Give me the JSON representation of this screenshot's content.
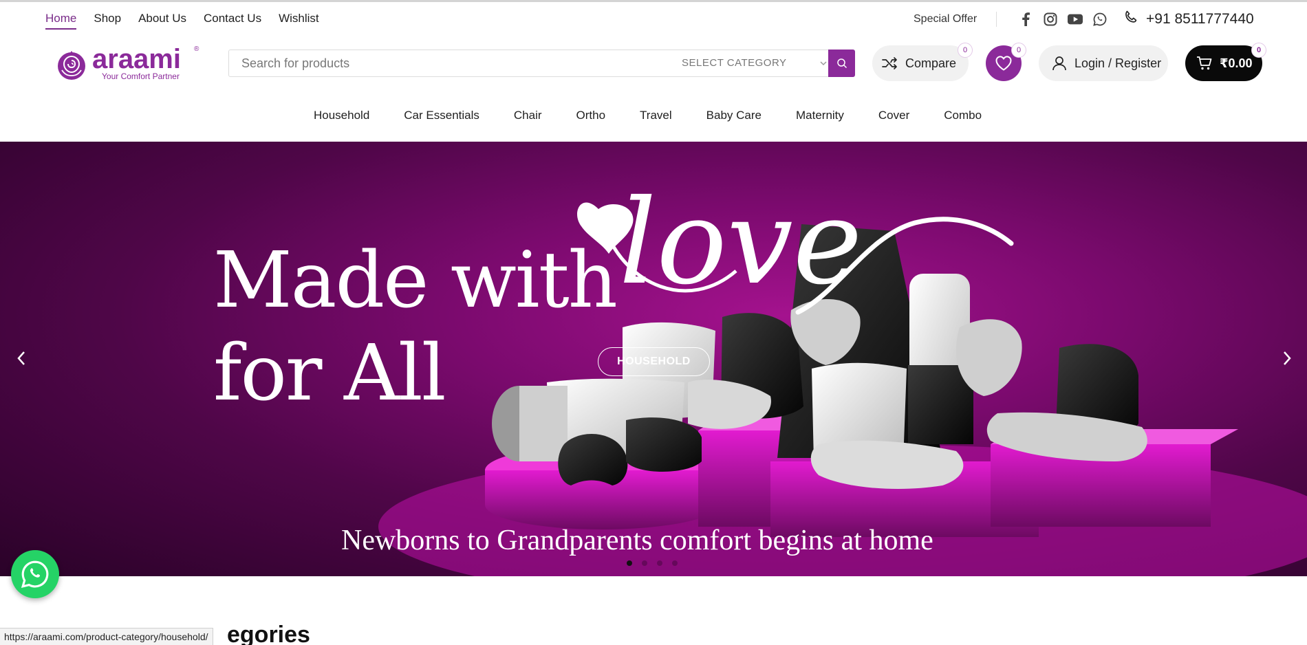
{
  "top_nav": [
    {
      "label": "Home",
      "active": true
    },
    {
      "label": "Shop"
    },
    {
      "label": "About Us"
    },
    {
      "label": "Contact Us"
    },
    {
      "label": "Wishlist"
    }
  ],
  "special_offer": "Special Offer",
  "socials": [
    "facebook-icon",
    "instagram-icon",
    "youtube-icon",
    "whatsapp-icon"
  ],
  "phone": "+91 8511777440",
  "logo": {
    "name": "araami",
    "tagline": "Your Comfort Partner",
    "reg": "®"
  },
  "search": {
    "placeholder": "Search for products",
    "category": "SELECT CATEGORY"
  },
  "compare": {
    "label": "Compare",
    "count": "0"
  },
  "wishlist": {
    "count": "0"
  },
  "login": {
    "label": "Login / Register"
  },
  "cart": {
    "total": "₹0.00",
    "count": "0"
  },
  "categories": [
    "Household",
    "Car Essentials",
    "Chair",
    "Ortho",
    "Travel",
    "Baby Care",
    "Maternity",
    "Cover",
    "Combo"
  ],
  "hero": {
    "line1": "Made with",
    "love": "love",
    "line2": "for All",
    "button": "HOUSEHOLD",
    "subtitle": "Newborns to Grandparents comfort begins at home",
    "slides": 4,
    "active_slide": 1
  },
  "section_title": "egories",
  "status_url": "https://araami.com/product-category/household/",
  "colors": {
    "brand": "#8b2a9a",
    "cart_bg": "#0a0a0a",
    "whatsapp": "#25d366"
  }
}
